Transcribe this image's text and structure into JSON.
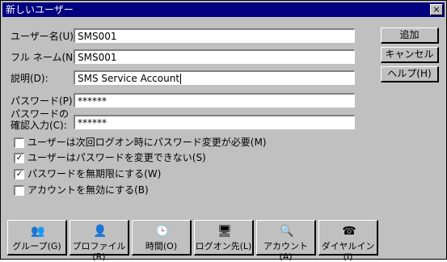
{
  "window": {
    "title": "新しいユーザー",
    "close_label": "×"
  },
  "fields": {
    "username": {
      "label": "ユーザー名(U):",
      "value": "SMS001"
    },
    "fullname": {
      "label": "フル ネーム(N):",
      "value": "SMS001"
    },
    "description": {
      "label": "説明(D):",
      "value": "SMS Service Account"
    },
    "password": {
      "label": "パスワード(P):",
      "value": "******"
    },
    "confirm": {
      "label_line1": "パスワードの",
      "label_line2": "確認入力(C):",
      "value": "******"
    }
  },
  "checkboxes": [
    {
      "label": "ユーザーは次回ログオン時にパスワード変更が必要(M)",
      "checked": false,
      "mark": ""
    },
    {
      "label": "ユーザーはパスワードを変更できない(S)",
      "checked": true,
      "mark": "✓"
    },
    {
      "label": "パスワードを無期限にする(W)",
      "checked": true,
      "mark": "✓"
    },
    {
      "label": "アカウントを無効にする(B)",
      "checked": false,
      "mark": ""
    }
  ],
  "side_buttons": {
    "add": "追加",
    "cancel": "キャンセル",
    "help": "ヘルプ(H)"
  },
  "bottom_buttons": [
    {
      "label": "グループ(G)",
      "icon": "group-icon",
      "glyph": "👥"
    },
    {
      "label": "プロファイル(R)",
      "icon": "profile-icon",
      "glyph": "👤"
    },
    {
      "label": "時間(O)",
      "icon": "clock-icon",
      "glyph": "🕒"
    },
    {
      "label": "ログオン先(L)",
      "icon": "logon-workstation-icon",
      "glyph": "🖥"
    },
    {
      "label": "アカウント(A)",
      "icon": "account-search-icon",
      "glyph": "🔍"
    },
    {
      "label": "ダイヤルイン(I)",
      "icon": "dialin-phone-icon",
      "glyph": "☎"
    }
  ]
}
